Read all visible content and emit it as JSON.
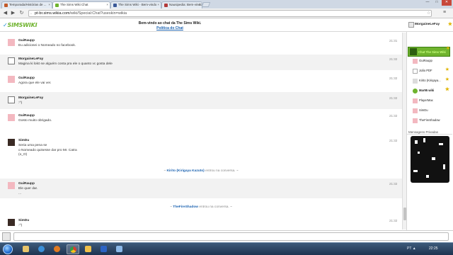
{
  "browser": {
    "tabs": [
      {
        "title": "Temporada/Histórias de ...",
        "active": false,
        "color": "#c25a2a"
      },
      {
        "title": "The Sims Wiki Chat",
        "active": true,
        "color": "#6fb32e"
      },
      {
        "title": "The Sims Wiki - Bem-vindo",
        "active": false,
        "color": "#3b5998"
      },
      {
        "title": "Nausipedia: Bem-vindo",
        "active": false,
        "color": "#b23a3a"
      }
    ],
    "url_host": "pt-br.sims.wikia.com",
    "url_path": "/wiki/Special:Chat?useskin=wikia"
  },
  "chat": {
    "logo_v": "✓",
    "logo_text": "SIMSWIKI",
    "welcome": "Bem-vindo ao chat da The Sims Wiki.",
    "policy_link": "Política do Chat",
    "current_user": "MorgaineLeFay",
    "messages": [
      {
        "user": "GuiRaupp",
        "text": "Eu adicionei o Nomeado no facebook.",
        "time": "21:31",
        "avatar": "pink"
      },
      {
        "user": "MorgaineLeFay",
        "text": "Magina ki lokö se alguém conta pra ele o quanto vc gosta dele",
        "time": "21:32",
        "avatar": "sketch"
      },
      {
        "user": "GuiRaupp",
        "text": "Agora que ele vai ver.",
        "time": "21:32",
        "avatar": "pink"
      },
      {
        "user": "MorgaineLeFay",
        "text": ":^)",
        "time": "21:32",
        "avatar": "sketch"
      },
      {
        "user": "GuiRaupp",
        "text": "Gosto muito obrigado.",
        "time": "21:32",
        "avatar": "pink"
      },
      {
        "user": "SimDu",
        "text": "Seria uma pena se\no Nomeado quisesse dar pro Mr. Catra\n(o_O)",
        "time": "21:32",
        "avatar": "dark"
      },
      {
        "user": "GuiRaupp",
        "text": "Ele quer dar.\n...",
        "time": "21:32",
        "avatar": "pink"
      },
      {
        "user": "SimDu",
        "text": ":^)",
        "time": "21:32",
        "avatar": "dark"
      }
    ],
    "inline_alerts": [
      {
        "prefix": "~ ",
        "user": "Kirito (Kirigaya Kazuto)",
        "text": " entrou na conversa. ~"
      },
      {
        "prefix": "~ ",
        "user": "TheFireShadow",
        "text": " entrou na conversa. ~"
      }
    ]
  },
  "sidebar": {
    "room_name": "Chat The Sims Wiki",
    "users": [
      {
        "name": "GuiRaupp",
        "star": false,
        "bold": false,
        "avatar": "#f3b8c0"
      },
      {
        "name": "João PDF",
        "star": true,
        "bold": false,
        "avatar": "#ffffff"
      },
      {
        "name": "Kirito (Kiriqaya...",
        "star": true,
        "bold": false,
        "avatar": "#dcdcdc"
      },
      {
        "name": "Mar95 wiki",
        "star": true,
        "bold": true,
        "avatar": "#6fb32e"
      },
      {
        "name": "PlayerMax",
        "star": false,
        "bold": false,
        "avatar": "#f3b8c0"
      },
      {
        "name": "SimDu",
        "star": false,
        "bold": false,
        "avatar": "#f3b8c0"
      },
      {
        "name": "TheFireShadow",
        "star": false,
        "bold": false,
        "avatar": "#f3b8c0"
      }
    ],
    "pm_label": "Mensagens Privadas"
  },
  "taskbar": {
    "tray": "PT ▲",
    "clock": "22:25"
  }
}
